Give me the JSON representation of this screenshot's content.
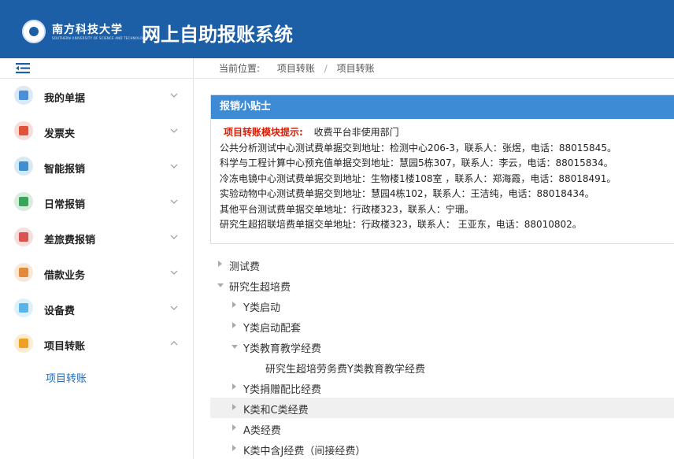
{
  "header": {
    "university_name": "南方科技大学",
    "university_en": "SOUTHERN UNIVERSITY OF SCIENCE AND TECHNOLOGY",
    "system_title": "网上自助报账系统"
  },
  "sidebar": {
    "items": [
      {
        "label": "我的单据",
        "icon": "document-icon",
        "color": "#4a90d9"
      },
      {
        "label": "发票夹",
        "icon": "invoice-icon",
        "color": "#e0523a"
      },
      {
        "label": "智能报销",
        "icon": "smart-reimburse-icon",
        "color": "#3e8fd0"
      },
      {
        "label": "日常报销",
        "icon": "money-icon",
        "color": "#3aa55a"
      },
      {
        "label": "差旅费报销",
        "icon": "car-icon",
        "color": "#d9534f"
      },
      {
        "label": "借款业务",
        "icon": "hand-money-icon",
        "color": "#e08a3a"
      },
      {
        "label": "设备费",
        "icon": "box-icon",
        "color": "#5bb4e6"
      },
      {
        "label": "项目转账",
        "icon": "transfer-icon",
        "color": "#f0a020"
      }
    ],
    "sub_items": [
      {
        "label": "项目转账"
      }
    ]
  },
  "breadcrumb": {
    "prefix": "当前位置:",
    "level1": "项目转账",
    "separator": "/",
    "level2": "项目转账"
  },
  "tips": {
    "header": "报销小贴士",
    "title": "项目转账模块提示:",
    "first_line_text": "收费平台非使用部门",
    "lines": [
      "公共分析测试中心测试费单据交到地址：检测中心206-3，联系人：张煜，电话：88015845。",
      "科学与工程计算中心预充值单据交到地址：慧园5栋307，联系人：李云，电话：88015834。",
      "冷冻电镜中心测试费单据交到地址：生物楼1楼108室 ，联系人：郑海霞，电话：88018491。",
      "实验动物中心测试费单据交到地址：慧园4栋102，联系人：王洁纯，电话：88018434。",
      "其他平台测试费单据交单地址：行政楼323，联系人：宁珊。",
      "研究生超招联培费单据交单地址：行政楼323，联系人： 王亚东，电话：88010802。"
    ]
  },
  "tree": [
    {
      "label": "测试费",
      "level": 0,
      "state": "collapsed"
    },
    {
      "label": "研究生超培费",
      "level": 0,
      "state": "expanded"
    },
    {
      "label": "Y类启动",
      "level": 1,
      "state": "collapsed"
    },
    {
      "label": "Y类启动配套",
      "level": 1,
      "state": "collapsed"
    },
    {
      "label": "Y类教育教学经费",
      "level": 1,
      "state": "expanded"
    },
    {
      "label": "研究生超培劳务费Y类教育教学经费",
      "level": 2,
      "state": "leaf"
    },
    {
      "label": "Y类捐赠配比经费",
      "level": 1,
      "state": "collapsed"
    },
    {
      "label": "K类和C类经费",
      "level": 1,
      "state": "collapsed",
      "highlight": true
    },
    {
      "label": "A类经费",
      "level": 1,
      "state": "collapsed"
    },
    {
      "label": "K类中含J经费（间接经费）",
      "level": 1,
      "state": "collapsed"
    }
  ]
}
